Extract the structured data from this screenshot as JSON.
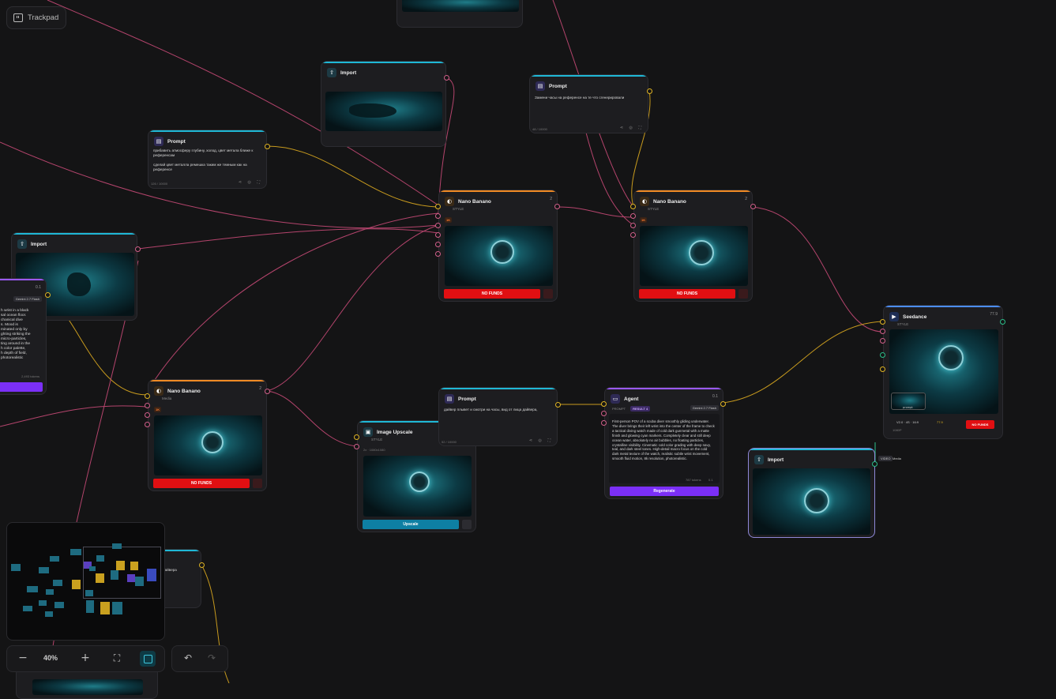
{
  "colors": {
    "import_accent": "#1fb8d6",
    "prompt_accent": "#1fb8d6",
    "banana_accent": "#f08a24",
    "agent_accent": "#9b59ff",
    "seedance_accent": "#4b8df8",
    "upscale_accent": "#1fb8d6",
    "no_funds_red": "#e10f12",
    "wire_pink": "#b4446c",
    "wire_yellow": "#c79a1e"
  },
  "toolbar": {
    "trackpad_label": "Trackpad",
    "zoom_level": "40%"
  },
  "icons": {
    "trackpad": "trackpad-icon",
    "import": "upload-icon",
    "prompt": "document-icon",
    "banana": "banana-icon",
    "agent": "chat-icon",
    "seedance": "video-icon",
    "upscale": "upscale-icon"
  },
  "nodes": {
    "import_top": {
      "title": "Import"
    },
    "prompt_top_right": {
      "title": "Prompt",
      "text": "Замени часы на референсе на те что сгенерировали",
      "count": "48 / 10000"
    },
    "prompt_left": {
      "title": "Prompt",
      "text": "прибавить атмосферу глубину, холод, цвет метала ближе к референсам\n\nсделай цвет металла ремешка таким же темным как на референсе",
      "count": "126 / 10000"
    },
    "import_left": {
      "title": "Import"
    },
    "banana_center": {
      "title": "Nano Banano",
      "sub": "STYLE",
      "cost": "2",
      "tag": "1K",
      "no_funds": "NO FUNDS"
    },
    "banana_right": {
      "title": "Nano Banano",
      "sub": "STYLE",
      "cost": "2",
      "tag": "1K",
      "no_funds": "NO FUNDS"
    },
    "agent_left_partial": {
      "cost": "0.1",
      "model_badge": "Gemini 2.7 Flash",
      "text": "h wrist in a black\nsal ocean floor.\nchanical dive\ns. Mood is\nminated only by\nghting striking the\nmicro-particles,\nting around in the\nh color palette,\nh depth of field,\nphotorealistic",
      "tokens": "2,493 tokens"
    },
    "banana_lower": {
      "title": "Nano Banano",
      "sub": "Media",
      "cost": "2",
      "tag": "1K",
      "no_funds": "NO FUNDS"
    },
    "prompt_middle": {
      "title": "Prompt",
      "text": "дайвер плывет и смотри на часы, вид от лица дайвера,",
      "count": "52 / 10000"
    },
    "image_upscale": {
      "title": "Image Upscale",
      "sub": "STYLE",
      "meta": "2x · 1080x1080",
      "button": "Upscale"
    },
    "agent": {
      "title": "Agent",
      "cost": "0.1",
      "tabs": [
        "PROMPT",
        "RESULT 4"
      ],
      "model_badge": "Gemini 2.7 Flash",
      "text": "First-person POV of a scuba diver smoothly gliding underwater. The diver brings their left wrist into the center of the frame to check a tactical diving watch made of cold dark gunmetal with a matte finish and glowing cyan markers. Completely clear and still deep ocean water, absolutely no air bubbles, no floating particles, crystalline visibility. Cinematic cold color grading with deep navy, teal, and dark steel tones. High-detail macro focus on the cold dark metal texture of the watch, realistic subtle wrist movement, smooth fluid motion, 8k resolution, photorealistic.",
      "tokens": "787 tokens",
      "small_cost": "0.1",
      "button": "Regenerate"
    },
    "seedance": {
      "title": "Seedance",
      "sub": "STYLE",
      "cost": "77.9",
      "settings": "V2.0 · 4S · 16:9",
      "price": "77.9",
      "no_funds": "NO FUNDS",
      "small_label": "prompt",
      "bottom": "1080P"
    },
    "import_right": {
      "title": "Import",
      "port_label_1": "VIDEO",
      "port_label_2": "Media"
    },
    "partial_bottom": {
      "text": "дайвера"
    }
  }
}
